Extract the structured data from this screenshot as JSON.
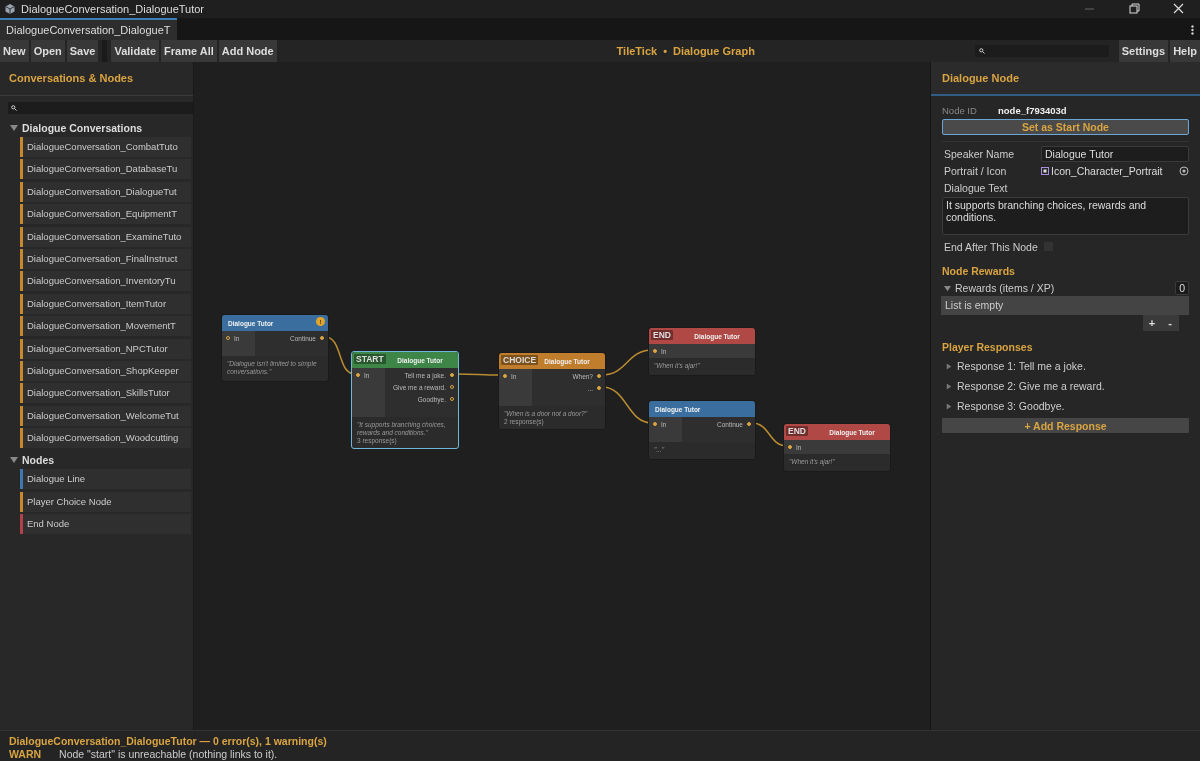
{
  "window": {
    "title": "DialogueConversation_DialogueTutor"
  },
  "tabs": [
    {
      "label": "DialogueConversation_DialogueT",
      "selected": true
    }
  ],
  "toolbar": {
    "file_buttons": [
      "New",
      "Open",
      "Save"
    ],
    "graph_buttons": [
      "Validate",
      "Frame All",
      "Add Node"
    ],
    "brand": "TileTick",
    "separator": "•",
    "title": "Dialogue Graph",
    "right_buttons": [
      "Settings",
      "Help"
    ]
  },
  "sidebar": {
    "title": "Conversations & Nodes",
    "groups": [
      {
        "label": "Dialogue Conversations",
        "expanded": true,
        "items": [
          {
            "label": "DialogueConversation_CombatTuto",
            "color": "#c8882e"
          },
          {
            "label": "DialogueConversation_DatabaseTu",
            "color": "#c8882e"
          },
          {
            "label": "DialogueConversation_DialogueTut",
            "color": "#c8882e"
          },
          {
            "label": "DialogueConversation_EquipmentT",
            "color": "#c8882e"
          },
          {
            "label": "DialogueConversation_ExamineTuto",
            "color": "#c8882e"
          },
          {
            "label": "DialogueConversation_FinalInstruct",
            "color": "#c8882e"
          },
          {
            "label": "DialogueConversation_InventoryTu",
            "color": "#c8882e"
          },
          {
            "label": "DialogueConversation_ItemTutor",
            "color": "#c8882e"
          },
          {
            "label": "DialogueConversation_MovementT",
            "color": "#c8882e"
          },
          {
            "label": "DialogueConversation_NPCTutor",
            "color": "#c8882e"
          },
          {
            "label": "DialogueConversation_ShopKeeper",
            "color": "#c8882e"
          },
          {
            "label": "DialogueConversation_SkillsTutor",
            "color": "#c8882e"
          },
          {
            "label": "DialogueConversation_WelcomeTut",
            "color": "#c8882e"
          },
          {
            "label": "DialogueConversation_Woodcutting",
            "color": "#c8882e"
          }
        ]
      },
      {
        "label": "Nodes",
        "expanded": true,
        "items": [
          {
            "label": "Dialogue Line",
            "color": "#3d78b0"
          },
          {
            "label": "Player Choice Node",
            "color": "#c8882e"
          },
          {
            "label": "End Node",
            "color": "#b0404a"
          }
        ]
      }
    ]
  },
  "graph": {
    "nodes": [
      {
        "kind": "line",
        "title": "Dialogue Tutor",
        "warning_badge": "!",
        "selected": false,
        "input": {
          "label": "In",
          "connected": false
        },
        "outputs": [
          {
            "label": "Continue",
            "connected": true
          }
        ],
        "text": "\"Dialogue isn't limited to simple conversations.\""
      },
      {
        "kind": "start",
        "badge": "START",
        "title": "Dialogue Tutor",
        "selected": true,
        "input": {
          "label": "In",
          "connected": true
        },
        "outputs": [
          {
            "label": "Tell me a joke.",
            "connected": true
          },
          {
            "label": "Give me a reward.",
            "connected": false
          },
          {
            "label": "Goodbye.",
            "connected": false
          }
        ],
        "text": "\"It supports branching choices, rewards and conditions.\"",
        "responses": "3 response(s)"
      },
      {
        "kind": "choice",
        "badge": "CHOICE",
        "title": "Dialogue Tutor",
        "selected": false,
        "input": {
          "label": "In",
          "connected": true
        },
        "outputs": [
          {
            "label": "When?",
            "connected": true
          },
          {
            "label": "...",
            "connected": true
          }
        ],
        "text": "\"When is a door not a door?\"",
        "responses": "2 response(s)"
      },
      {
        "kind": "end",
        "badge": "END",
        "title": "Dialogue Tutor",
        "selected": false,
        "input": {
          "label": "In",
          "connected": true
        },
        "text": "\"When it's ajar!\""
      },
      {
        "kind": "line",
        "title": "Dialogue Tutor",
        "selected": false,
        "input": {
          "label": "In",
          "connected": true
        },
        "outputs": [
          {
            "label": "Continue",
            "connected": true
          }
        ],
        "text": "\"...\""
      },
      {
        "kind": "end",
        "badge": "END",
        "title": "Dialogue Tutor",
        "selected": false,
        "input": {
          "label": "In",
          "connected": true
        },
        "text": "\"When it's ajar!\""
      }
    ]
  },
  "inspector": {
    "title": "Dialogue Node",
    "node_id_label": "Node ID",
    "node_id": "node_f793403d",
    "start_button": "Set as Start Node",
    "fields": [
      {
        "kind": "text",
        "label": "Speaker Name",
        "value": "Dialogue Tutor"
      },
      {
        "kind": "object",
        "label": "Portrait / Icon",
        "value": "Icon_Character_Portrait"
      },
      {
        "kind": "textarea",
        "label": "Dialogue Text",
        "value": "It supports branching choices, rewards and conditions."
      },
      {
        "kind": "checkbox",
        "label": "End After This Node",
        "checked": false
      }
    ],
    "rewards": {
      "title": "Node Rewards",
      "label": "Rewards (items / XP)",
      "expanded": true,
      "count": "0",
      "empty_text": "List is empty",
      "add": "+",
      "remove": "-"
    },
    "responses": {
      "title": "Player Responses",
      "items": [
        {
          "label": "Response 1: Tell me a joke.",
          "expanded": false
        },
        {
          "label": "Response 2: Give me a reward.",
          "expanded": false
        },
        {
          "label": "Response 3: Goodbye.",
          "expanded": false
        }
      ],
      "add_button": "+ Add Response"
    }
  },
  "status_bar": {
    "summary": "DialogueConversation_DialogueTutor — 0 error(s), 1 warning(s)",
    "messages": [
      {
        "level": "WARN",
        "text": "Node \"start\" is unreachable (nothing links to it)."
      }
    ]
  }
}
